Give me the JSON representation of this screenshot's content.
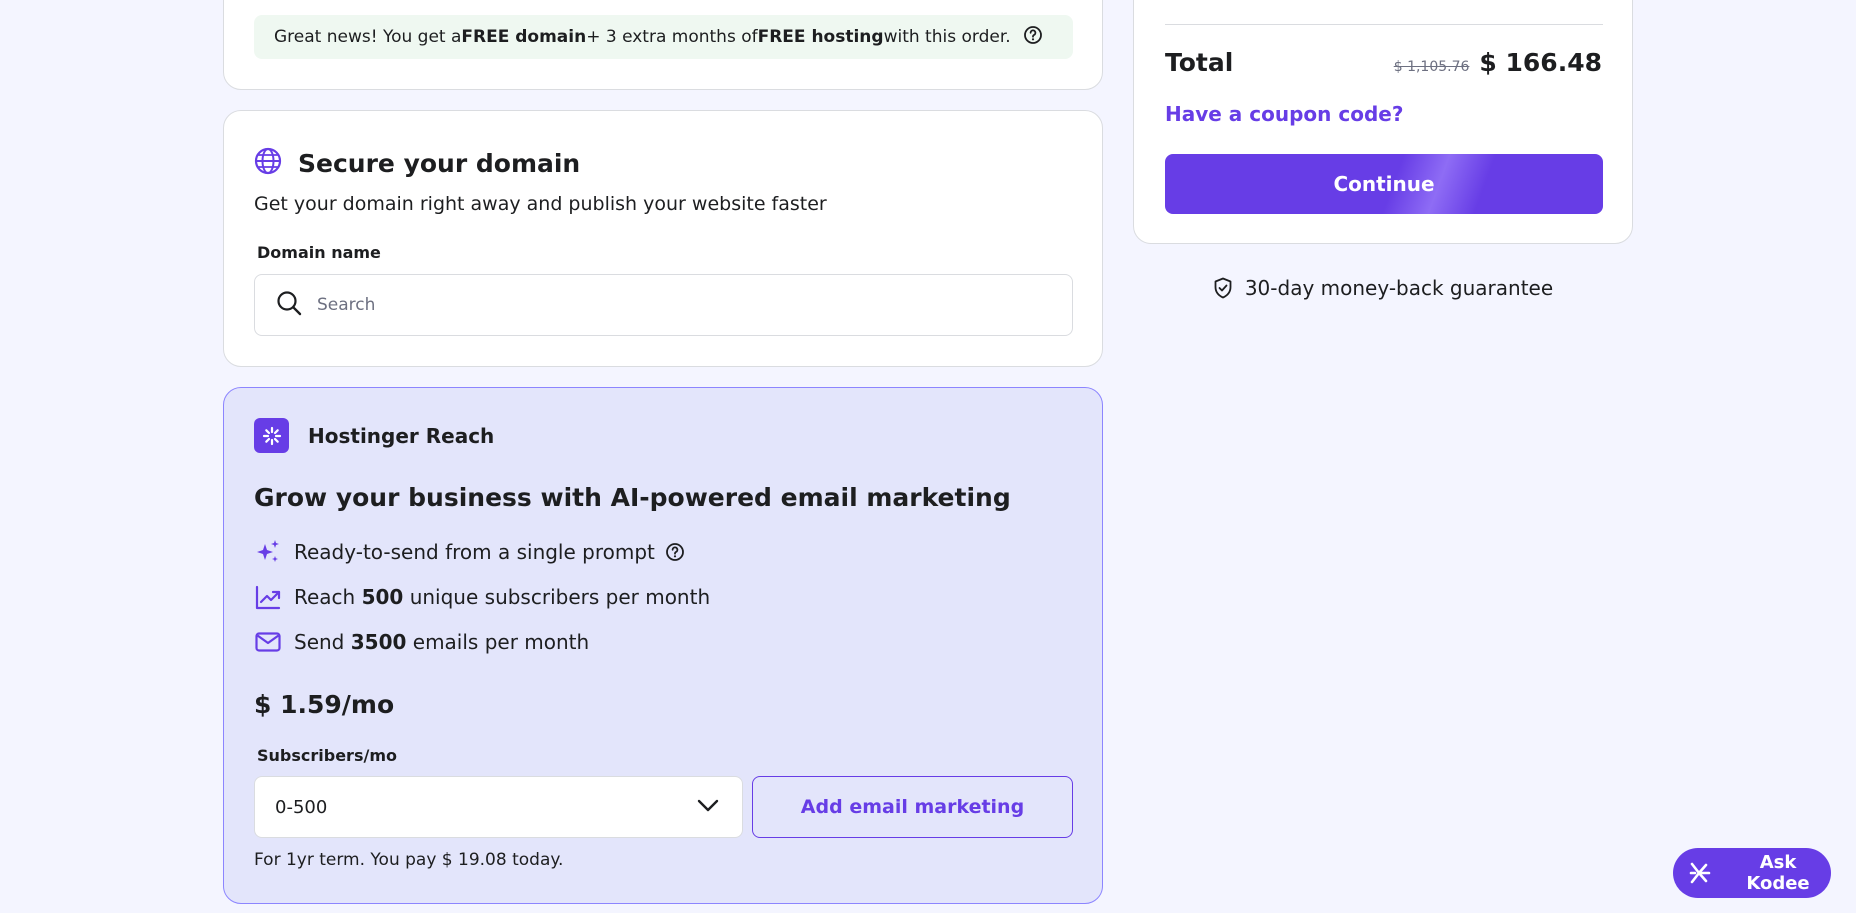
{
  "promo": {
    "prefix": "Great news! You get a ",
    "free_domain": "FREE domain",
    "middle": " + 3 extra months of ",
    "free_hosting": "FREE hosting",
    "suffix": " with this order."
  },
  "domain_section": {
    "title": "Secure your domain",
    "subtitle": "Get your domain right away and publish your website faster",
    "field_label": "Domain name",
    "search_placeholder": "Search",
    "search_value": ""
  },
  "reach": {
    "product_name": "Hostinger Reach",
    "headline": "Grow your business with AI-powered email marketing",
    "features": [
      {
        "icon": "sparkles-icon",
        "text": "Ready-to-send from a single prompt"
      },
      {
        "icon": "trend-chart-icon",
        "prefix": "Reach ",
        "value": "500",
        "suffix": " unique subscribers per month"
      },
      {
        "icon": "mail-icon",
        "prefix": "Send ",
        "value": "3500",
        "suffix": " emails per month"
      }
    ],
    "price": "$ 1.59/mo",
    "subscribers_label": "Subscribers/mo",
    "subscribers_selected": "0-500",
    "add_button": "Add email marketing",
    "term_note": "For 1yr term. You pay $ 19.08 today."
  },
  "summary": {
    "total_label": "Total",
    "old_price": "$ 1,105.76",
    "new_price": "$ 166.48",
    "coupon_link": "Have a coupon code?",
    "continue_button": "Continue"
  },
  "guarantee": "30-day money-back guarantee",
  "kodee": {
    "label": "Ask Kodee"
  },
  "colors": {
    "accent": "#673de6",
    "background": "#f4f5ff",
    "promo_bg": "#eff8f1",
    "reach_bg": "#e3e5fb",
    "reach_border": "#8c85ff"
  }
}
